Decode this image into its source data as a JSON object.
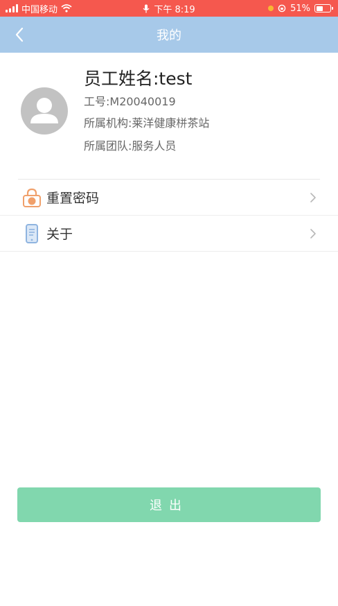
{
  "status_bar": {
    "carrier": "中国移动",
    "time": "下午 8:19",
    "battery_percent": "51%",
    "battery_level": 0.51
  },
  "nav": {
    "title": "我的",
    "back_icon": "chevron-left-icon"
  },
  "profile": {
    "name": "员工姓名:test",
    "employee_id": "工号:M20040019",
    "organization": "所属机构:莱洋健康栟茶站",
    "team": "所属团队:服务人员",
    "avatar_icon": "user-avatar-icon"
  },
  "menu": {
    "items": [
      {
        "label": "重置密码",
        "icon": "lock-icon",
        "icon_color": "#f0a06b"
      },
      {
        "label": "关于",
        "icon": "phone-icon",
        "icon_color": "#8fb4e0"
      }
    ]
  },
  "logout": {
    "label": "退出",
    "color": "#81d7ae"
  },
  "colors": {
    "status_bar": "#f5584e",
    "nav_bar": "#a7c9e9"
  }
}
